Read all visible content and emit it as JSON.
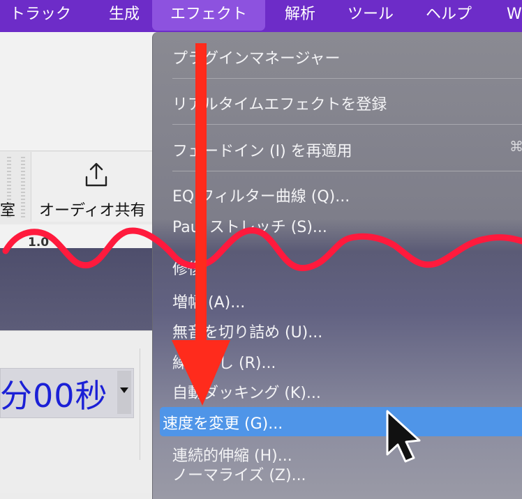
{
  "menubar": {
    "items": [
      {
        "label": "トラック"
      },
      {
        "label": "生成"
      },
      {
        "label": "エフェクト"
      },
      {
        "label": "解析"
      },
      {
        "label": "ツール"
      },
      {
        "label": "ヘルプ"
      },
      {
        "label": "W"
      }
    ],
    "active_index": 2
  },
  "toolbar": {
    "partial_label": "室",
    "share_label": "オーディオ共有",
    "share_icon": "share-upload-icon"
  },
  "ruler": {
    "value": "1.0"
  },
  "time_display": {
    "value": "分00秒"
  },
  "effect_menu": {
    "items": [
      {
        "label": "プラグインマネージャー"
      },
      {
        "label": "リアルタイムエフェクトを登録"
      },
      {
        "label": "フェードイン (I) を再適用"
      },
      {
        "label": "EQ フィルター曲線 (Q)..."
      },
      {
        "label": "Paul ストレッチ (S)..."
      },
      {
        "label": "修復"
      },
      {
        "label": "増幅 (A)..."
      },
      {
        "label": "無音を切り詰め (U)..."
      },
      {
        "label": "繰り返し (R)..."
      },
      {
        "label": "自動ダッキング (K)..."
      },
      {
        "label": "速度を変更 (G)..."
      },
      {
        "label": "連続的伸縮 (H)..."
      },
      {
        "label": "ノーマライズ (Z)..."
      }
    ],
    "highlighted_index": 10,
    "shortcut_glyph": "⌘"
  },
  "colors": {
    "menubar": "#6d2cc8",
    "highlight": "#4f95e8",
    "annotation_red": "#ff1a3d",
    "time_text": "#1b20d6"
  }
}
